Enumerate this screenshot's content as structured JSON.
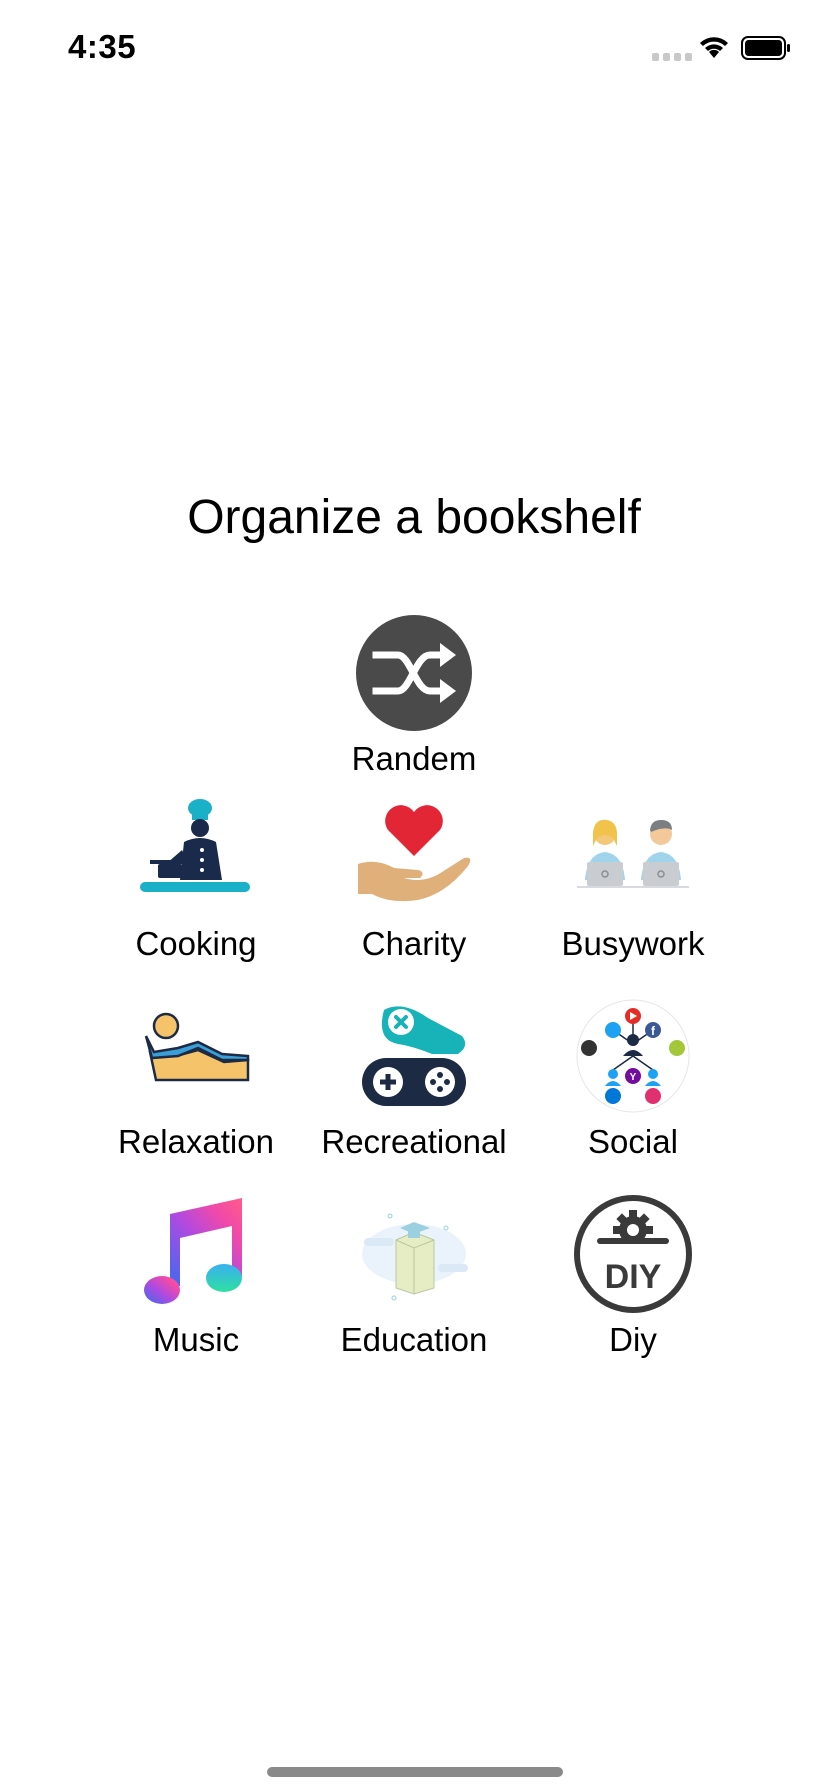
{
  "status_bar": {
    "time": "4:35"
  },
  "title": "Organize a bookshelf",
  "categories": [
    {
      "label": "Randem",
      "icon": "shuffle-icon"
    },
    {
      "label": "Cooking",
      "icon": "chef-icon"
    },
    {
      "label": "Charity",
      "icon": "heart-hand-icon"
    },
    {
      "label": "Busywork",
      "icon": "office-workers-icon"
    },
    {
      "label": "Relaxation",
      "icon": "lounging-person-icon"
    },
    {
      "label": "Recreational",
      "icon": "game-controller-icon"
    },
    {
      "label": "Social",
      "icon": "social-network-icon"
    },
    {
      "label": "Music",
      "icon": "music-note-icon"
    },
    {
      "label": "Education",
      "icon": "education-box-icon"
    },
    {
      "label": "Diy",
      "icon": "diy-gear-icon"
    }
  ],
  "colors": {
    "shuffle_bg": "#4a4a4a",
    "chef_navy": "#1a2a4a",
    "chef_teal": "#1ab0c8",
    "heart_red": "#e32636",
    "hand_tan": "#e0b07a",
    "relax_yellow": "#f5c46a",
    "relax_blue": "#3a9fd6",
    "game_teal": "#17b3b8",
    "game_navy": "#1d2a44",
    "diy_gray": "#3a3a3a"
  }
}
